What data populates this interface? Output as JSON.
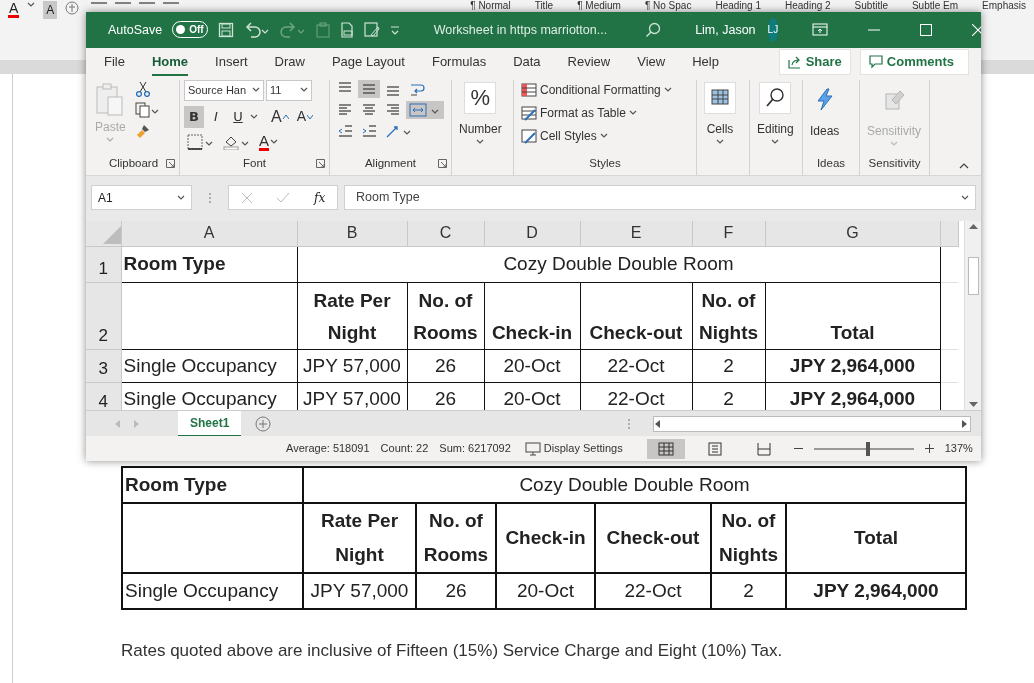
{
  "word": {
    "toolbar": {
      "font_color": "A",
      "shading": "A",
      "styles": [
        "¶ Normal",
        "Title",
        "¶ Medium",
        "¶ No Spac",
        "Heading 1",
        "Heading 2",
        "Subtitle",
        "Subtle Em",
        "Emphasis"
      ]
    },
    "table": {
      "rows": [
        {
          "cells": [
            {
              "text": "Room Type",
              "bold": true
            },
            {
              "text": "Cozy Double Double Room",
              "bold": false,
              "colspan": 6
            }
          ]
        },
        {
          "cells": [
            {},
            {
              "text": "Rate Per Night",
              "bold": true
            },
            {
              "text": "No. of Rooms",
              "bold": true
            },
            {
              "text": "Check-in",
              "bold": true
            },
            {
              "text": "Check-out",
              "bold": true
            },
            {
              "text": "No. of Nights",
              "bold": true
            },
            {
              "text": "Total",
              "bold": true
            }
          ]
        },
        {
          "cells": [
            {
              "text": "Single Occupancy",
              "bold": false
            },
            {
              "text": "JPY 57,000",
              "bold": false
            },
            {
              "text": "26",
              "bold": false
            },
            {
              "text": "20-Oct",
              "bold": false
            },
            {
              "text": "22-Oct",
              "bold": false
            },
            {
              "text": "2",
              "bold": false
            },
            {
              "text": "JPY 2,964,000",
              "bold": true
            }
          ]
        }
      ]
    },
    "note": "Rates quoted above are inclusive of Fifteen (15%) Service Charge and Eight (10%) Tax."
  },
  "excel": {
    "title_bar": {
      "autosave": "AutoSave",
      "autosave_on": false,
      "toggle_label": "Off",
      "document": "Worksheet in https  marriotton...",
      "user": "Lim, Jason",
      "initials": "LJ"
    },
    "tabs": [
      {
        "label": "File",
        "selected": false
      },
      {
        "label": "Home",
        "selected": true
      },
      {
        "label": "Insert",
        "selected": false
      },
      {
        "label": "Draw",
        "selected": false
      },
      {
        "label": "Page Layout",
        "selected": false
      },
      {
        "label": "Formulas",
        "selected": false
      },
      {
        "label": "Data",
        "selected": false
      },
      {
        "label": "Review",
        "selected": false
      },
      {
        "label": "View",
        "selected": false
      },
      {
        "label": "Help",
        "selected": false
      }
    ],
    "share": "Share",
    "comments": "Comments",
    "ribbon": [
      {
        "kind": "clipboard",
        "label": "Clipboard",
        "paste": "Paste"
      },
      {
        "kind": "font",
        "label": "Font",
        "font_name": "Source Han",
        "font_size": "11",
        "style_buttons": [
          {
            "label": "B",
            "on": true
          },
          {
            "label": "I",
            "on": false
          },
          {
            "label": "U",
            "on": false
          }
        ],
        "grow": "A",
        "shrink": "A",
        "font_color": "A"
      },
      {
        "kind": "alignment",
        "label": "Alignment",
        "center_on": true,
        "merge_on": true
      },
      {
        "kind": "number",
        "symbol": "%",
        "button": "Number"
      },
      {
        "kind": "styles",
        "label": "Styles",
        "items": [
          "Conditional Formatting",
          "Format as Table",
          "Cell Styles"
        ]
      },
      {
        "kind": "large",
        "button": "Cells",
        "dropdown": true,
        "disabled": false
      },
      {
        "kind": "large",
        "button": "Editing",
        "dropdown": true,
        "disabled": false
      },
      {
        "kind": "large",
        "button": "Ideas",
        "label": "Ideas",
        "dropdown": false,
        "disabled": false
      },
      {
        "kind": "large",
        "button": "Sensitivity",
        "label": "Sensitivity",
        "dropdown": true,
        "disabled": true
      }
    ],
    "name_box": "A1",
    "function_label": "fx",
    "formula": "Room Type",
    "columns": [
      "A",
      "B",
      "C",
      "D",
      "E",
      "F",
      "G"
    ],
    "rows": [
      {
        "header": "1",
        "cells": [
          {
            "text": "Room Type",
            "bold": true
          },
          {
            "text": "Cozy Double Double Room",
            "bold": false,
            "colspan": 6
          }
        ]
      },
      {
        "header": "2",
        "cells": [
          {},
          {
            "text": "Rate Per Night",
            "bold": true
          },
          {
            "text": "No. of Rooms",
            "bold": true
          },
          {
            "text": "Check-in",
            "bold": true
          },
          {
            "text": "Check-out",
            "bold": true
          },
          {
            "text": "No. of Nights",
            "bold": true
          },
          {
            "text": "Total",
            "bold": true
          }
        ]
      },
      {
        "header": "3",
        "cells": [
          {
            "text": "Single Occupancy",
            "bold": false
          },
          {
            "text": "JPY 57,000",
            "bold": false
          },
          {
            "text": "26",
            "bold": false
          },
          {
            "text": "20-Oct",
            "bold": false
          },
          {
            "text": "22-Oct",
            "bold": false
          },
          {
            "text": "2",
            "bold": false
          },
          {
            "text": "JPY 2,964,000",
            "bold": true
          }
        ]
      },
      {
        "header": "4",
        "cells": [
          {
            "text": "Single Occupancy",
            "bold": false
          },
          {
            "text": "JPY 57,000",
            "bold": false
          },
          {
            "text": "26",
            "bold": false
          },
          {
            "text": "20-Oct",
            "bold": false
          },
          {
            "text": "22-Oct",
            "bold": false
          },
          {
            "text": "2",
            "bold": false
          },
          {
            "text": "JPY 2,964,000",
            "bold": true
          }
        ]
      }
    ],
    "sheets": [
      {
        "label": "Sheet1",
        "selected": true
      }
    ],
    "status": {
      "average": "Average: 518091",
      "count": "Count: 22",
      "sum": "Sum: 6217092",
      "display": "Display Settings",
      "views": [
        {
          "kind": "normal",
          "selected": true
        },
        {
          "kind": "page_layout",
          "selected": false
        },
        {
          "kind": "page_break",
          "selected": false
        }
      ],
      "zoom": {
        "label": "137%",
        "level": 0.54
      }
    }
  }
}
